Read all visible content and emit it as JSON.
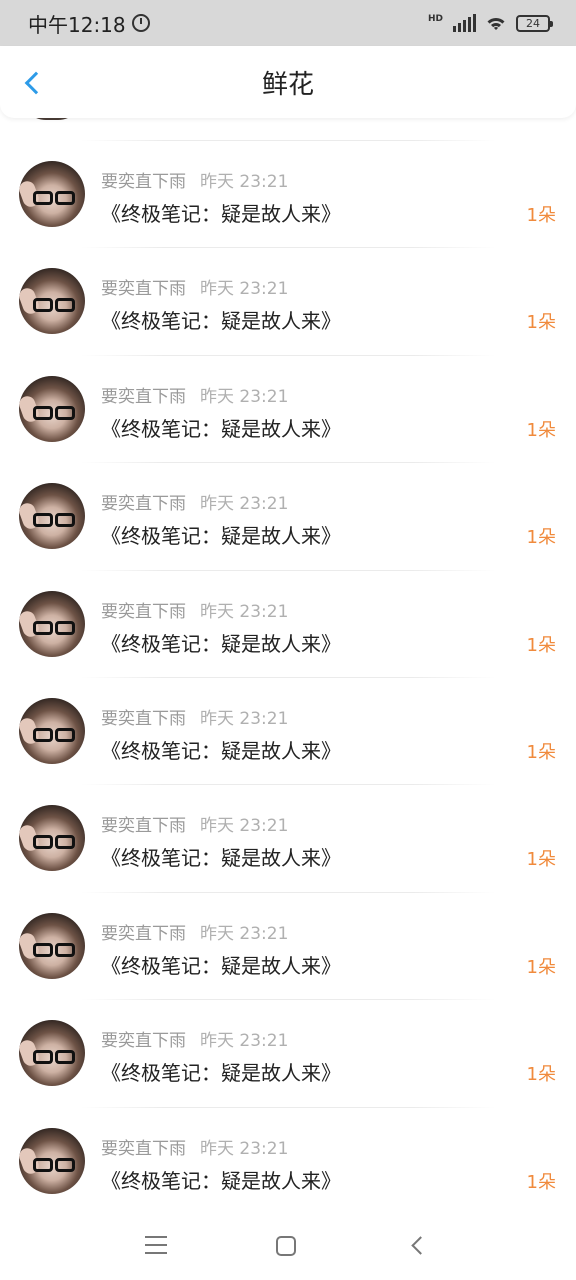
{
  "status_bar": {
    "time": "中午12:18",
    "network": "HD",
    "battery": "24"
  },
  "header": {
    "title": "鲜花",
    "back_icon": "chevron-left-icon",
    "accent": "#2d9be8"
  },
  "colors": {
    "amount": "#f08a3c"
  },
  "items": [
    {
      "user": "要奕直下雨",
      "time": "昨天 23:21",
      "title": "《终极笔记：疑是故人来》",
      "amount": "1朵"
    },
    {
      "user": "要奕直下雨",
      "time": "昨天 23:21",
      "title": "《终极笔记：疑是故人来》",
      "amount": "1朵"
    },
    {
      "user": "要奕直下雨",
      "time": "昨天 23:21",
      "title": "《终极笔记：疑是故人来》",
      "amount": "1朵"
    },
    {
      "user": "要奕直下雨",
      "time": "昨天 23:21",
      "title": "《终极笔记：疑是故人来》",
      "amount": "1朵"
    },
    {
      "user": "要奕直下雨",
      "time": "昨天 23:21",
      "title": "《终极笔记：疑是故人来》",
      "amount": "1朵"
    },
    {
      "user": "要奕直下雨",
      "time": "昨天 23:21",
      "title": "《终极笔记：疑是故人来》",
      "amount": "1朵"
    },
    {
      "user": "要奕直下雨",
      "time": "昨天 23:21",
      "title": "《终极笔记：疑是故人来》",
      "amount": "1朵"
    },
    {
      "user": "要奕直下雨",
      "time": "昨天 23:21",
      "title": "《终极笔记：疑是故人来》",
      "amount": "1朵"
    },
    {
      "user": "要奕直下雨",
      "time": "昨天 23:21",
      "title": "《终极笔记：疑是故人来》",
      "amount": "1朵"
    },
    {
      "user": "要奕直下雨",
      "time": "昨天 23:21",
      "title": "《终极笔记：疑是故人来》",
      "amount": "1朵"
    }
  ],
  "nav": {
    "menu_icon": "menu-icon",
    "home_icon": "home-icon",
    "back_icon": "back-icon"
  }
}
